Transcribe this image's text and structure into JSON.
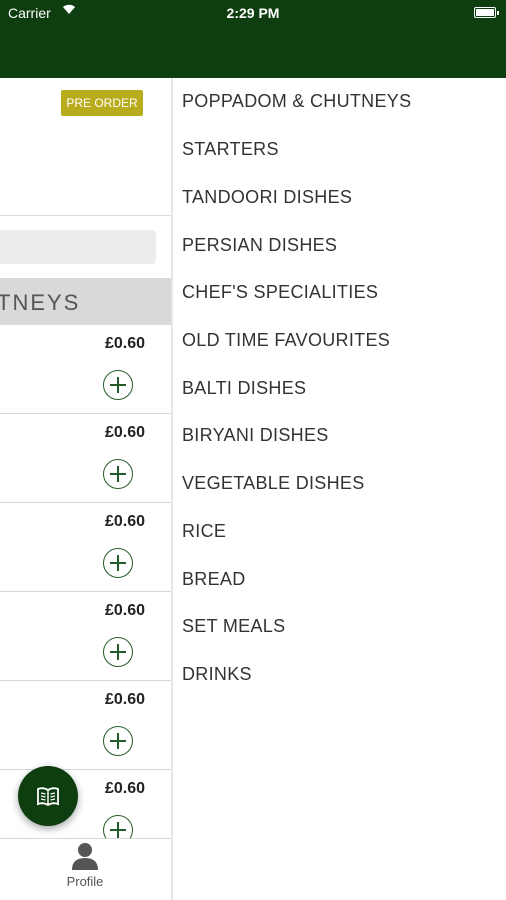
{
  "status_bar": {
    "carrier": "Carrier",
    "time": "2:29 PM"
  },
  "left_panel": {
    "preorder_label": "PRE ORDER",
    "category_header": "TNEYS",
    "items": [
      {
        "price": "£0.60"
      },
      {
        "price": "£0.60"
      },
      {
        "price": "£0.60"
      },
      {
        "price": "£0.60"
      },
      {
        "price": "£0.60"
      },
      {
        "price": "£0.60"
      }
    ]
  },
  "tab_bar": {
    "profile_label": "Profile"
  },
  "categories": [
    "POPPADOM & CHUTNEYS",
    "STARTERS",
    "TANDOORI DISHES",
    "PERSIAN DISHES",
    "CHEF'S SPECIALITIES",
    "OLD TIME FAVOURITES",
    "BALTI DISHES",
    "BIRYANI DISHES",
    "VEGETABLE DISHES",
    "RICE",
    "BREAD",
    "SET MEALS",
    "DRINKS"
  ],
  "colors": {
    "brand_green": "#0e3d10",
    "preorder_badge": "#b9ac1c"
  }
}
